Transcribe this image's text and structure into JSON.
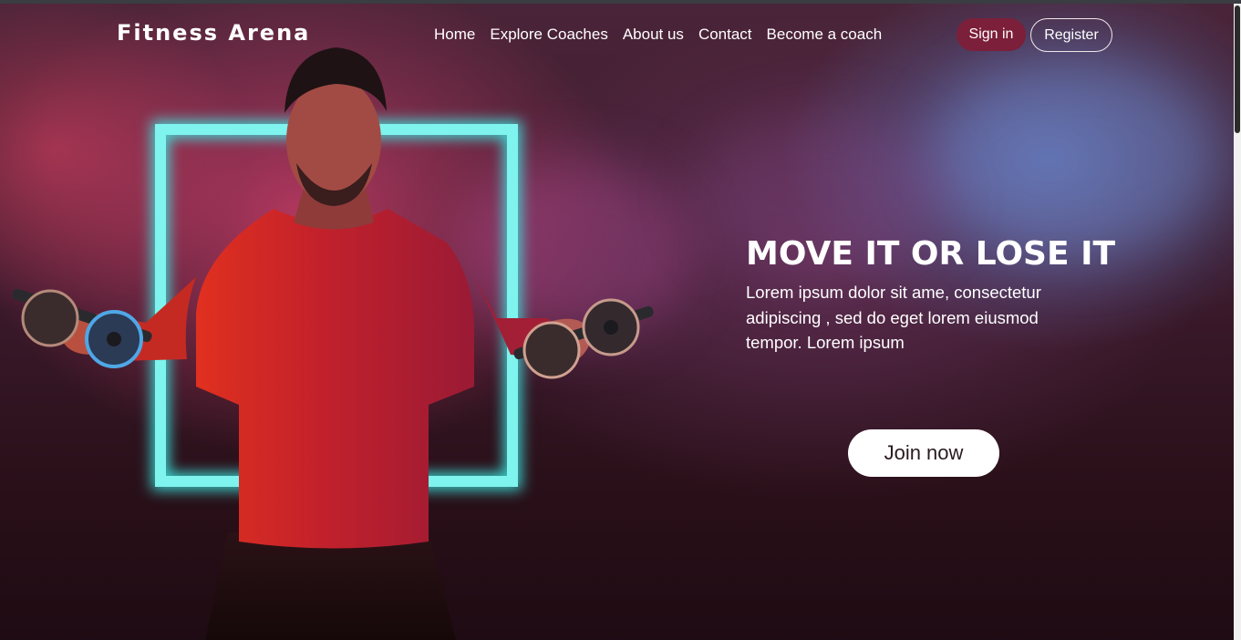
{
  "brand": {
    "name": "Fitness Arena"
  },
  "nav": {
    "items": [
      "Home",
      "Explore Coaches",
      "About us",
      "Contact",
      "Become a coach"
    ]
  },
  "auth": {
    "signin_label": "Sign in",
    "register_label": "Register"
  },
  "hero": {
    "headline": "MOVE IT OR LOSE IT",
    "text": "Lorem ipsum dolor sit ame, consectetur adipiscing , sed do eget lorem eiusmod tempor. Lorem ipsum",
    "cta_label": "Join now"
  },
  "colors": {
    "accent": "#7b1f3a",
    "neon": "#7ff3ee",
    "shirt": "#c2212b"
  }
}
